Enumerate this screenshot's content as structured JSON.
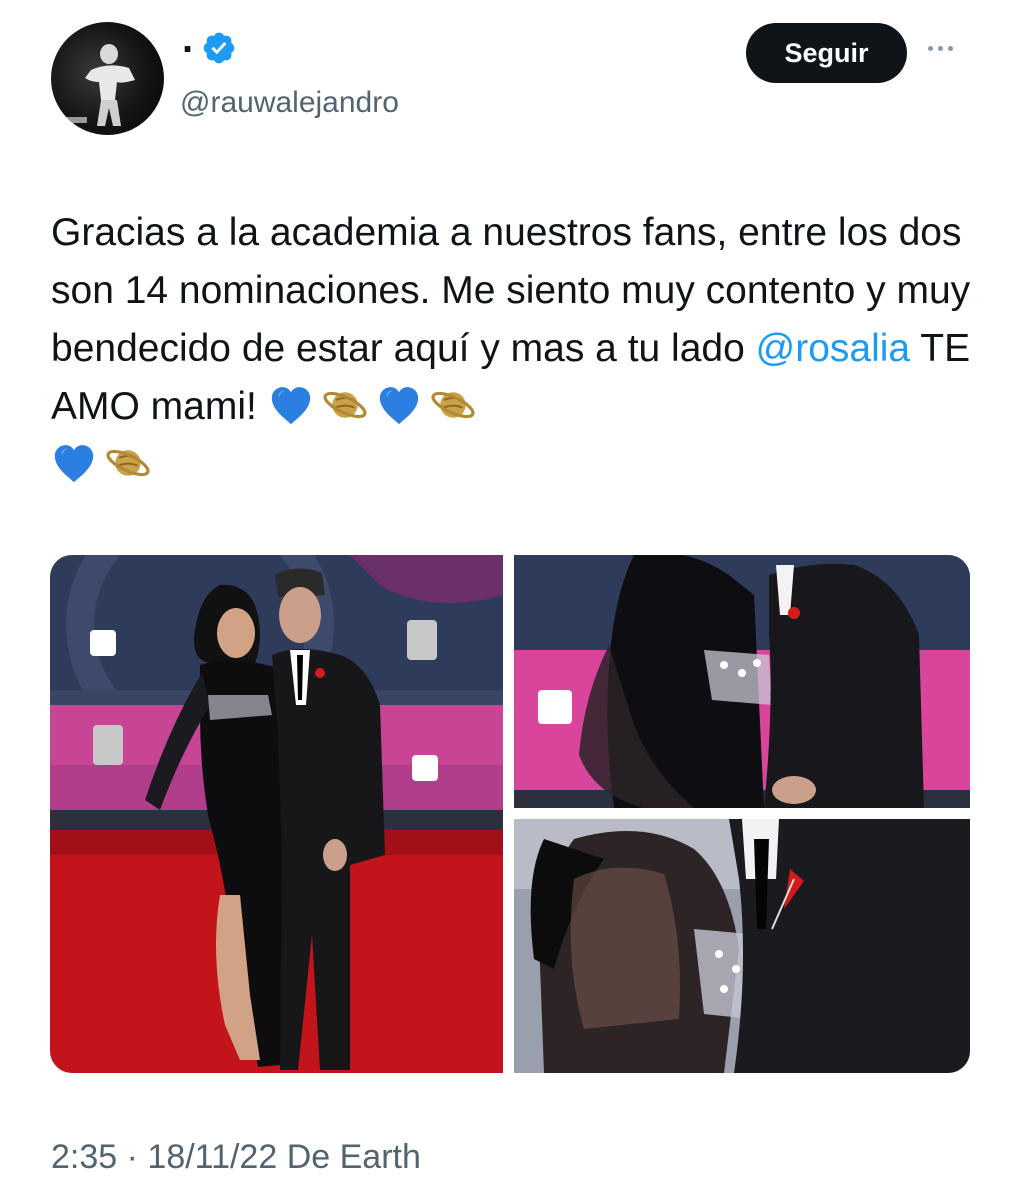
{
  "tweet": {
    "display_name": ".",
    "handle": "@rauwalejandro",
    "follow_label": "Seguir",
    "text_before_mention": "Gracias a la academia a nuestros fans, entre los dos son 14 nominaciones. Me siento muy contento y muy bendecido de estar aquí y mas a tu lado ",
    "mention": "@rosalia",
    "text_after_mention": " TE AMO mami! ",
    "emojis": [
      "blue-heart",
      "ringed-planet",
      "blue-heart",
      "ringed-planet",
      "blue-heart",
      "ringed-planet"
    ],
    "time": "2:35",
    "separator": "·",
    "date": "18/11/22",
    "source": "De Earth"
  },
  "media": {
    "photo_count": 3,
    "photos": [
      "couple-red-carpet-full",
      "couple-closeup-upper",
      "couple-closeup-lower"
    ]
  },
  "colors": {
    "accent": "#1d9bf0",
    "text": "#0f1419",
    "secondary": "#536471",
    "button_bg": "#0f1419"
  }
}
